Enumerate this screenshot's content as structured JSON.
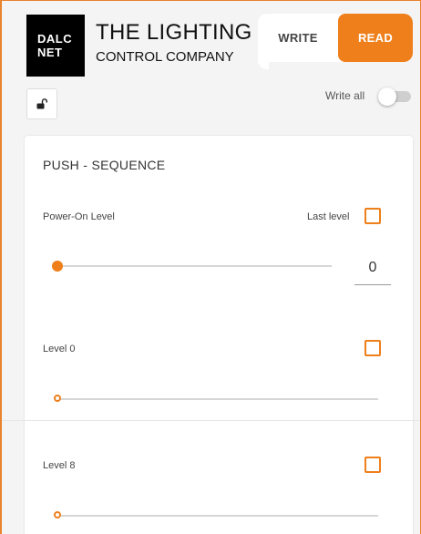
{
  "header": {
    "logo_line1": "DALC",
    "logo_line2": "NET",
    "title": "THE LIGHTING",
    "subtitle": "CONTROL COMPANY",
    "mode_write": "WRITE",
    "mode_read": "READ",
    "active_mode": "READ"
  },
  "toolbar": {
    "lock_icon": "unlock-icon",
    "write_all_label": "Write all",
    "write_all_on": false
  },
  "card": {
    "title": "PUSH - SEQUENCE",
    "power_on": {
      "label": "Power-On Level",
      "last_level_label": "Last level",
      "last_level_checked": false,
      "value": "0"
    },
    "levels": [
      {
        "label": "Level 0",
        "checked": false
      },
      {
        "label": "Level 8",
        "checked": false
      }
    ]
  },
  "colors": {
    "accent": "#ee7f1b",
    "track": "#d6d6d6",
    "logo_bg": "#000000"
  }
}
